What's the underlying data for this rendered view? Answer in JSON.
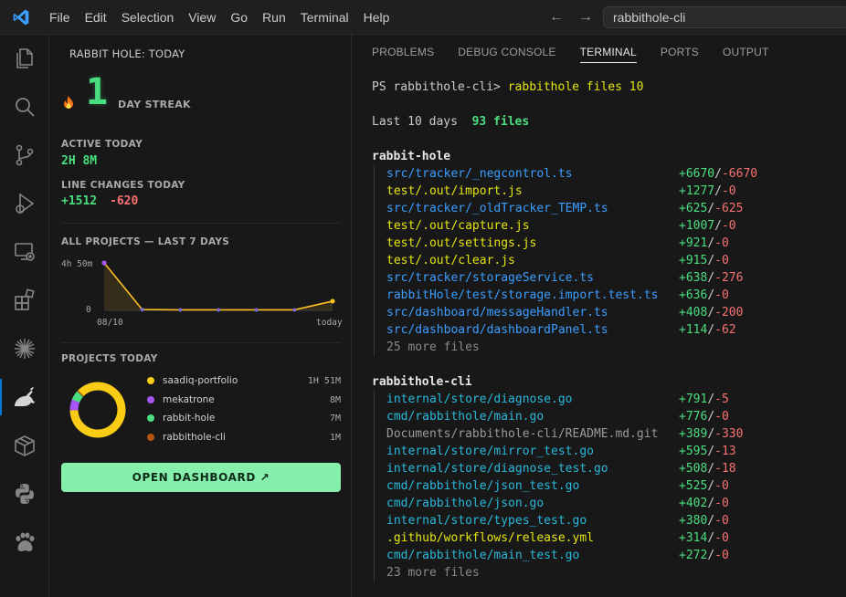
{
  "menu": [
    "File",
    "Edit",
    "Selection",
    "View",
    "Go",
    "Run",
    "Terminal",
    "Help"
  ],
  "search": {
    "value": "rabbithole-cli"
  },
  "activity_icons": [
    "explorer-icon",
    "search-icon",
    "source-control-icon",
    "run-debug-icon",
    "remote-explorer-icon",
    "extensions-icon",
    "sparkle-icon",
    "rabbit-hole-icon",
    "package-icon",
    "python-icon",
    "paw-icon"
  ],
  "sidebar": {
    "title": "RABBIT HOLE: TODAY",
    "streak": {
      "number": "1",
      "label": "DAY STREAK"
    },
    "active_today": {
      "label": "ACTIVE TODAY",
      "value": "2H 8M"
    },
    "line_changes": {
      "label": "LINE CHANGES TODAY",
      "added": "+1512",
      "removed": "-620"
    },
    "weekly": {
      "label": "ALL PROJECTS — LAST 7 DAYS",
      "y_max_label": "4h 50m",
      "y_min_label": "0",
      "x_start_label": "08/10",
      "x_end_label": "today"
    },
    "projects": {
      "label": "PROJECTS TODAY",
      "items": [
        {
          "name": "saadiq-portfolio",
          "time": "1H 51M",
          "color": "#facc15"
        },
        {
          "name": "mekatrone",
          "time": "8M",
          "color": "#a855f7"
        },
        {
          "name": "rabbit-hole",
          "time": "7M",
          "color": "#4ade80"
        },
        {
          "name": "rabbithole-cli",
          "time": "1M",
          "color": "#b45309"
        }
      ]
    },
    "open_dashboard": "OPEN DASHBOARD ↗"
  },
  "chart_data": {
    "type": "line",
    "x": [
      "08/10",
      "",
      "",
      "",
      "",
      "",
      "today"
    ],
    "values": [
      290,
      5,
      3,
      3,
      3,
      3,
      56
    ],
    "ylim": [
      0,
      290
    ],
    "ylabel": "",
    "xlabel": "",
    "title": "ALL PROJECTS — LAST 7 DAYS",
    "color": "#fbbf24"
  },
  "donut_data": {
    "type": "pie",
    "categories": [
      "saadiq-portfolio",
      "mekatrone",
      "rabbit-hole",
      "rabbithole-cli"
    ],
    "values": [
      111,
      8,
      7,
      1
    ],
    "colors": [
      "#facc15",
      "#a855f7",
      "#4ade80",
      "#b45309"
    ]
  },
  "panel": {
    "tabs": [
      "PROBLEMS",
      "DEBUG CONSOLE",
      "TERMINAL",
      "PORTS",
      "OUTPUT"
    ],
    "active_tab": "TERMINAL"
  },
  "terminal": {
    "prompt": "PS rabbithole-cli> ",
    "command": "rabbithole files 10",
    "summary_prefix": "Last 10 days  ",
    "summary_count": "93 files",
    "groups": [
      {
        "name": "rabbit-hole",
        "files": [
          {
            "path": "src/tracker/_negcontrol.ts",
            "added": "+6670",
            "removed": "-6670",
            "color": "#3b9eff"
          },
          {
            "path": "test/.out/import.js",
            "added": "+1277",
            "removed": "-0",
            "color": "#e5e510"
          },
          {
            "path": "src/tracker/_oldTracker_TEMP.ts",
            "added": "+625",
            "removed": "-625",
            "color": "#3b9eff"
          },
          {
            "path": "test/.out/capture.js",
            "added": "+1007",
            "removed": "-0",
            "color": "#e5e510"
          },
          {
            "path": "test/.out/settings.js",
            "added": "+921",
            "removed": "-0",
            "color": "#e5e510"
          },
          {
            "path": "test/.out/clear.js",
            "added": "+915",
            "removed": "-0",
            "color": "#e5e510"
          },
          {
            "path": "src/tracker/storageService.ts",
            "added": "+638",
            "removed": "-276",
            "color": "#3b9eff"
          },
          {
            "path": "rabbitHole/test/storage.import.test.ts",
            "added": "+636",
            "removed": "-0",
            "color": "#3b9eff"
          },
          {
            "path": "src/dashboard/messageHandler.ts",
            "added": "+408",
            "removed": "-200",
            "color": "#3b9eff"
          },
          {
            "path": "src/dashboard/dashboardPanel.ts",
            "added": "+114",
            "removed": "-62",
            "color": "#3b9eff"
          }
        ],
        "more": "25 more files"
      },
      {
        "name": "rabbithole-cli",
        "files": [
          {
            "path": "internal/store/diagnose.go",
            "added": "+791",
            "removed": "-5",
            "color": "#29b8db"
          },
          {
            "path": "cmd/rabbithole/main.go",
            "added": "+776",
            "removed": "-0",
            "color": "#29b8db"
          },
          {
            "path": "Documents/rabbithole-cli/README.md.git",
            "added": "+389",
            "removed": "-330",
            "color": "#9a9a9a"
          },
          {
            "path": "internal/store/mirror_test.go",
            "added": "+595",
            "removed": "-13",
            "color": "#29b8db"
          },
          {
            "path": "internal/store/diagnose_test.go",
            "added": "+508",
            "removed": "-18",
            "color": "#29b8db"
          },
          {
            "path": "cmd/rabbithole/json_test.go",
            "added": "+525",
            "removed": "-0",
            "color": "#29b8db"
          },
          {
            "path": "cmd/rabbithole/json.go",
            "added": "+402",
            "removed": "-0",
            "color": "#29b8db"
          },
          {
            "path": "internal/store/types_test.go",
            "added": "+380",
            "removed": "-0",
            "color": "#29b8db"
          },
          {
            "path": ".github/workflows/release.yml",
            "added": "+314",
            "removed": "-0",
            "color": "#e5e510"
          },
          {
            "path": "cmd/rabbithole/main_test.go",
            "added": "+272",
            "removed": "-0",
            "color": "#29b8db"
          }
        ],
        "more": "23 more files"
      }
    ]
  }
}
